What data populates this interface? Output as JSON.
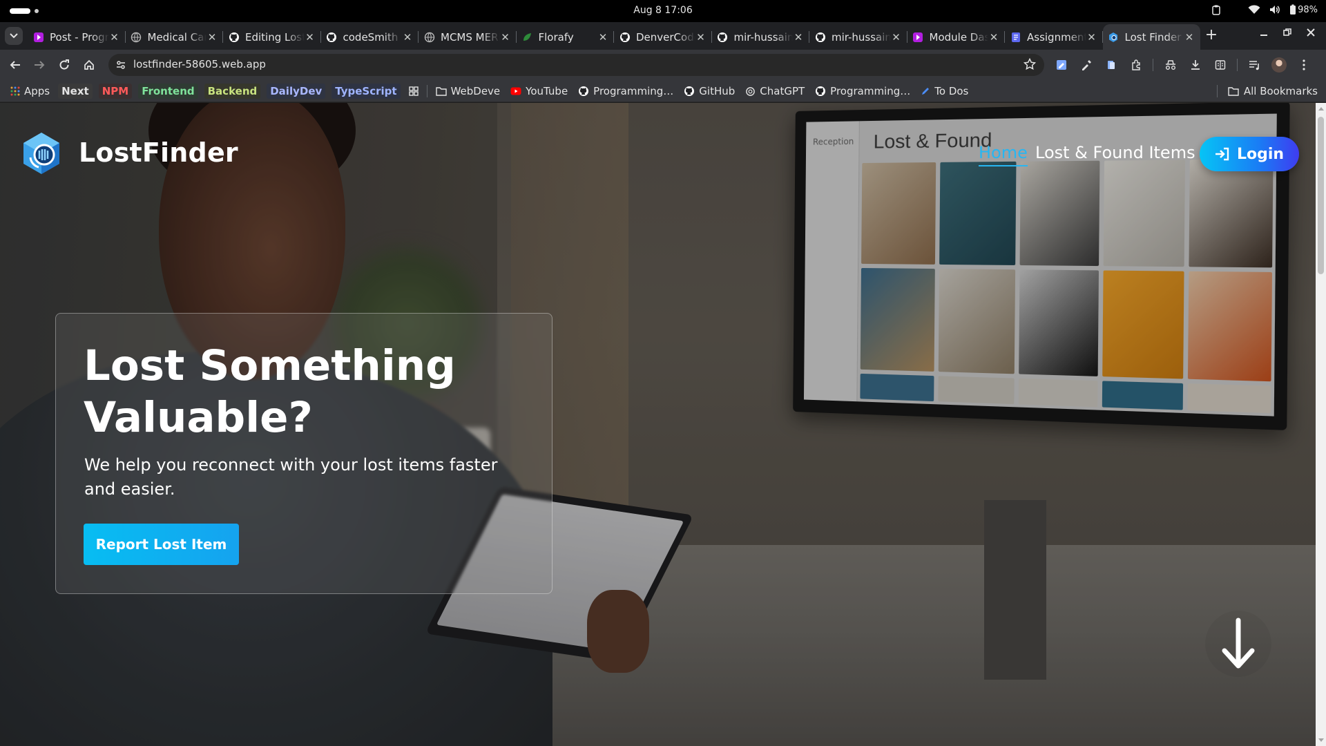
{
  "os": {
    "datetime": "Aug 8  17:06",
    "battery": "98%",
    "icons": [
      "clipboard-icon",
      "wifi-icon",
      "volume-icon",
      "battery-icon"
    ]
  },
  "tabs": [
    {
      "title": "Post - Programming",
      "favicon": "programming-hero-icon",
      "color": "#b11ee0",
      "active": false
    },
    {
      "title": "Medical Camp",
      "favicon": "globe-icon",
      "color": "#777",
      "active": false
    },
    {
      "title": "Editing LostFinder",
      "favicon": "github-icon",
      "color": "#fff",
      "active": false
    },
    {
      "title": "codeSmith",
      "favicon": "github-icon",
      "color": "#fff",
      "active": false
    },
    {
      "title": "MCMS MERN",
      "favicon": "globe-icon",
      "color": "#777",
      "active": false
    },
    {
      "title": "Florafy",
      "favicon": "leaf-icon",
      "color": "#2e8b3a",
      "active": false
    },
    {
      "title": "DenverCode",
      "favicon": "github-icon",
      "color": "#fff",
      "active": false
    },
    {
      "title": "mir-hussain",
      "favicon": "github-icon",
      "color": "#fff",
      "active": false
    },
    {
      "title": "mir-hussain",
      "favicon": "github-icon",
      "color": "#fff",
      "active": false
    },
    {
      "title": "Module Dashboard",
      "favicon": "programming-hero-icon",
      "color": "#b11ee0",
      "active": false
    },
    {
      "title": "Assignment",
      "favicon": "docs-icon",
      "color": "#5d68f0",
      "active": false
    },
    {
      "title": "Lost Finder",
      "favicon": "lostfinder-icon",
      "color": "#3b9be8",
      "active": true
    }
  ],
  "toolbar": {
    "url": "lostfinder-58605.web.app"
  },
  "bookmarks": {
    "items": [
      {
        "label": "Apps",
        "icon": "apps-grid-icon",
        "type": "plain"
      },
      {
        "label": "Next",
        "type": "chip",
        "bg": "#3a3a3a",
        "fg": "#e3e3e3"
      },
      {
        "label": "NPM",
        "type": "chip",
        "bg": "#3a2f30",
        "fg": "#ff5a5a"
      },
      {
        "label": "Frontend",
        "type": "chip",
        "bg": "#2f3b33",
        "fg": "#7fe29b"
      },
      {
        "label": "Backend",
        "type": "chip",
        "bg": "#36372c",
        "fg": "#c8e27f"
      },
      {
        "label": "DailyDev",
        "type": "chip",
        "bg": "#2f3442",
        "fg": "#a9b7ff"
      },
      {
        "label": "TypeScript",
        "type": "chip",
        "bg": "#2e3343",
        "fg": "#9fb4ff"
      },
      {
        "label": "",
        "icon": "grid-icon",
        "type": "icon"
      },
      {
        "label": "WebDeve",
        "icon": "folder-icon",
        "type": "plain"
      },
      {
        "label": "YouTube",
        "icon": "youtube-icon",
        "type": "plain"
      },
      {
        "label": "Programming…",
        "icon": "github-icon",
        "type": "plain"
      },
      {
        "label": "GitHub",
        "icon": "github-icon",
        "type": "plain"
      },
      {
        "label": "ChatGPT",
        "icon": "chatgpt-icon",
        "type": "plain"
      },
      {
        "label": "Programming…",
        "icon": "github-icon",
        "type": "plain"
      },
      {
        "label": "To Dos",
        "icon": "pencil-icon",
        "type": "plain"
      }
    ],
    "all_label": "All Bookmarks"
  },
  "site": {
    "brand": "LostFinder",
    "nav": {
      "home": "Home",
      "items": "Lost & Found Items",
      "login": "Login"
    },
    "hero": {
      "title": "Lost Something Valuable?",
      "subtitle": "We help you reconnect with your lost items faster and easier.",
      "cta": "Report Lost Item"
    },
    "tv": {
      "title": "Lost & Found",
      "side": "Reception"
    },
    "colors": {
      "accent": "#27b6f2",
      "button": "#07bdf2"
    }
  }
}
